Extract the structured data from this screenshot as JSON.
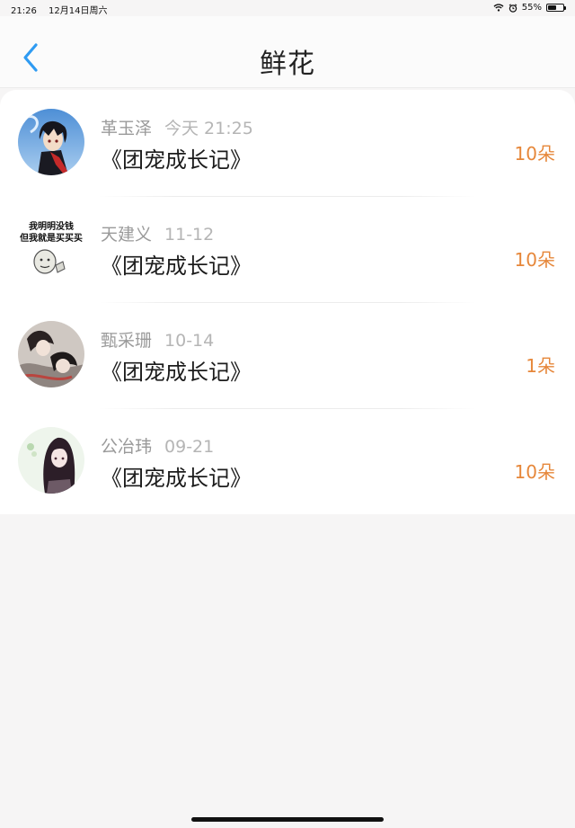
{
  "status_bar": {
    "time": "21:26",
    "date": "12月14日周六",
    "battery": "55%",
    "battery_level": 0.55,
    "icons": [
      "wifi-icon",
      "alarm-icon",
      "battery-icon"
    ]
  },
  "nav": {
    "title": "鲜花",
    "back_icon": "chevron-left-icon",
    "accent_color": "#2f9bf2"
  },
  "list": {
    "count_color": "#e6873a",
    "items": [
      {
        "name": "革玉泽",
        "date": "今天 21:25",
        "book": "《团宠成长记》",
        "count": "10朵",
        "avatar": "anime-boy-avatar"
      },
      {
        "name": "天建义",
        "date": "11-12",
        "book": "《团宠成长记》",
        "count": "10朵",
        "avatar": "meme-avatar",
        "avatar_text_1": "我明明没钱",
        "avatar_text_2": "但我就是买买买"
      },
      {
        "name": "甄采珊",
        "date": "10-14",
        "book": "《团宠成长记》",
        "count": "1朵",
        "avatar": "anime-pair-avatar"
      },
      {
        "name": "公冶玮",
        "date": "09-21",
        "book": "《团宠成长记》",
        "count": "10朵",
        "avatar": "anime-girl-avatar"
      }
    ]
  }
}
